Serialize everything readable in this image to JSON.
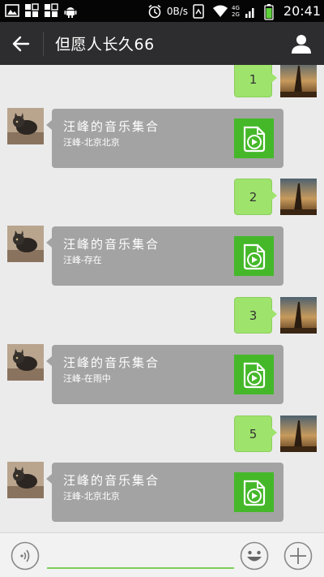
{
  "status_bar": {
    "net_speed": "0B/s",
    "net_4g": "4G",
    "net_2g": "2G",
    "time": "20:41",
    "icons": [
      "gallery-icon",
      "app-grid-icon",
      "app-grid-icon",
      "android-icon",
      "alarm-icon",
      "phone-signal-icon",
      "wifi-icon",
      "signal-icon",
      "battery-icon"
    ]
  },
  "title_bar": {
    "title": "但愿人长久66",
    "back_icon": "arrow-left-icon",
    "profile_icon": "person-icon"
  },
  "messages": [
    {
      "type": "text",
      "from": "self",
      "text": "1"
    },
    {
      "type": "music",
      "from": "other",
      "title": "汪峰的音乐集合",
      "subtitle": "汪峰-北京北京"
    },
    {
      "type": "text",
      "from": "self",
      "text": "2"
    },
    {
      "type": "music",
      "from": "other",
      "title": "汪峰的音乐集合",
      "subtitle": "汪峰-存在"
    },
    {
      "type": "text",
      "from": "self",
      "text": "3"
    },
    {
      "type": "music",
      "from": "other",
      "title": "汪峰的音乐集合",
      "subtitle": "汪峰-在雨中"
    },
    {
      "type": "text",
      "from": "self",
      "text": "5"
    },
    {
      "type": "music",
      "from": "other",
      "title": "汪峰的音乐集合",
      "subtitle": "汪峰-北京北京"
    }
  ],
  "input_bar": {
    "value": "",
    "voice_icon": "voice-icon",
    "emoji_icon": "emoji-icon",
    "plus_icon": "plus-icon"
  },
  "colors": {
    "title_bar": "#2d2d2f",
    "self_bubble": "#9ee36c",
    "music_card": "#a3a3a3",
    "music_icon_bg": "#45b82a",
    "input_underline": "#7fcf5a"
  }
}
